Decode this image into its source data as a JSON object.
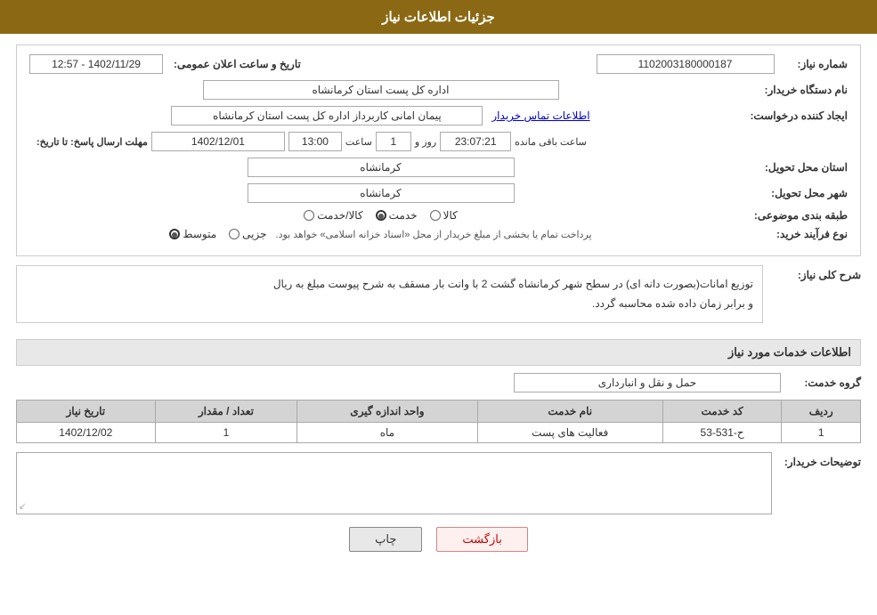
{
  "header": {
    "title": "جزئیات اطلاعات نیاز"
  },
  "fields": {
    "need_number_label": "شماره نیاز:",
    "need_number_value": "1102003180000187",
    "announce_date_label": "تاریخ و ساعت اعلان عمومی:",
    "announce_date_value": "1402/11/29 - 12:57",
    "org_name_label": "نام دستگاه خریدار:",
    "org_name_value": "اداره کل پست استان کرمانشاه",
    "creator_label": "ایجاد کننده درخواست:",
    "creator_value": "پیمان امانی کاربرداز اداره کل پست استان کرمانشاه",
    "contact_link": "اطلاعات تماس خریدار",
    "deadline_label": "مهلت ارسال پاسخ: تا تاریخ:",
    "deadline_date": "1402/12/01",
    "deadline_time_label": "ساعت",
    "deadline_time": "13:00",
    "deadline_days_label": "روز و",
    "deadline_days": "1",
    "remaining_label": "ساعت باقی مانده",
    "remaining_time": "23:07:21",
    "province_label": "استان محل تحویل:",
    "province_value": "کرمانشاه",
    "city_label": "شهر محل تحویل:",
    "city_value": "کرمانشاه",
    "category_label": "طبقه بندی موضوعی:",
    "category_options": [
      "کالا",
      "خدمت",
      "کالا/خدمت"
    ],
    "category_selected": "خدمت",
    "process_label": "نوع فرآیند خرید:",
    "process_options": [
      "جزیی",
      "متوسط"
    ],
    "process_selected": "متوسط",
    "process_note": "پرداخت تمام یا بخشی از مبلغ خریدار از محل «اسناد خزانه اسلامی» خواهد بود."
  },
  "description": {
    "section_title": "شرح کلی نیاز:",
    "text_line1": "توزیع امانات(بصورت دانه ای) در سطح شهر کرمانشاه گشت 2 با وانت بار مسقف به شرح پیوست مبلغ به ریال",
    "text_line2": "و برابر زمان داده شده محاسبه گردد."
  },
  "services": {
    "section_title": "اطلاعات خدمات مورد نیاز",
    "group_label": "گروه خدمت:",
    "group_value": "حمل و نقل و انبارداری",
    "table": {
      "headers": [
        "ردیف",
        "کد خدمت",
        "نام خدمت",
        "واحد اندازه گیری",
        "تعداد / مقدار",
        "تاریخ نیاز"
      ],
      "rows": [
        {
          "row": "1",
          "code": "ح-531-53",
          "name": "فعالیت های پست",
          "unit": "ماه",
          "quantity": "1",
          "date": "1402/12/02"
        }
      ]
    }
  },
  "buyer_notes": {
    "label": "توضیحات خریدار:"
  },
  "buttons": {
    "print": "چاپ",
    "back": "بازگشت"
  }
}
